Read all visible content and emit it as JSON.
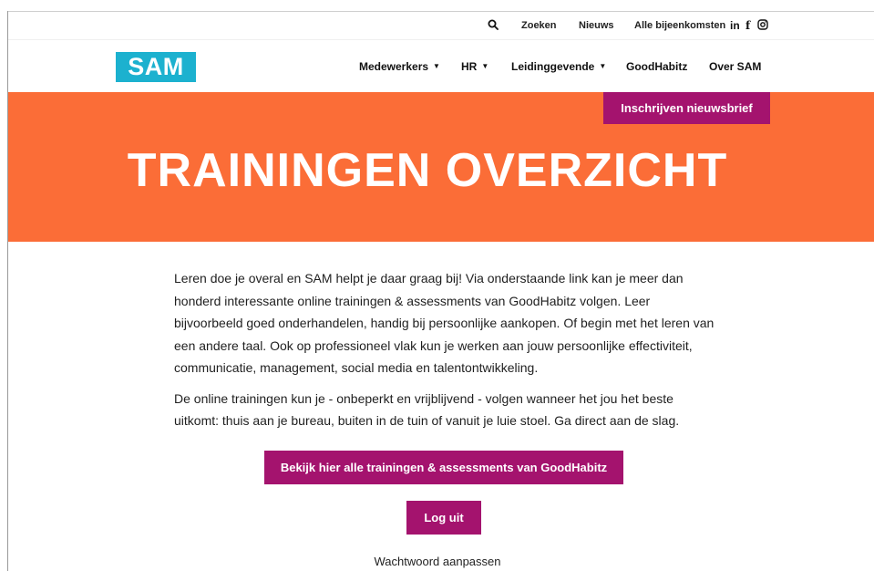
{
  "utility": {
    "search_icon": "search-icon",
    "search_label": "Zoeken",
    "news_label": "Nieuws",
    "events_label": "Alle bijeenkomsten",
    "linkedin": "in",
    "facebook": "f",
    "instagram_icon": "instagram-icon"
  },
  "nav": {
    "logo": "SAM",
    "items": [
      {
        "label": "Medewerkers",
        "dropdown": true
      },
      {
        "label": "HR",
        "dropdown": true
      },
      {
        "label": "Leidinggevende",
        "dropdown": true
      },
      {
        "label": "GoodHabitz",
        "dropdown": false
      },
      {
        "label": "Over SAM",
        "dropdown": false
      }
    ]
  },
  "hero": {
    "newsletter_label": "Inschrijven nieuwsbrief",
    "title": "TRAININGEN OVERZICHT"
  },
  "content": {
    "paragraphs": [
      "Leren doe je overal en SAM helpt je daar graag bij! Via onderstaande link kan je meer dan honderd interessante online trainingen & assessments van GoodHabitz volgen. Leer bijvoorbeeld goed onderhandelen, handig bij persoonlijke aankopen. Of begin met het leren van een andere taal. Ook op professioneel vlak kun je werken aan jouw persoonlijke effectiviteit, communicatie, management, social media en talentontwikkeling.",
      "De online trainingen kun je - onbeperkt en vrijblijvend - volgen wanneer het jou het beste uitkomt: thuis aan je bureau, buiten in de tuin of vanuit je luie stoel. Ga direct aan de slag."
    ]
  },
  "actions": {
    "cta_label": "Bekijk hier alle trainingen & assessments van GoodHabitz",
    "logout_label": "Log uit",
    "password_label": "Wachtwoord aanpassen"
  },
  "colors": {
    "hero_orange": "#fb6d37",
    "accent_magenta": "#a4136e",
    "logo_cyan": "#1cb1cf"
  }
}
